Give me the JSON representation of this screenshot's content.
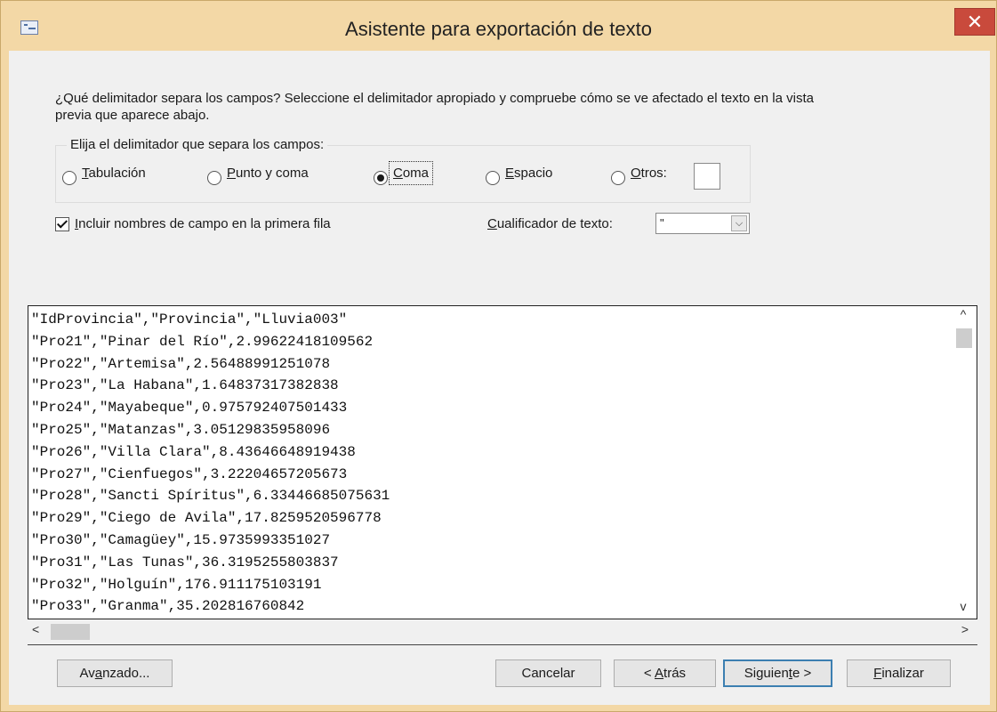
{
  "window": {
    "title": "Asistente para exportación de texto",
    "close_glyph": "✕",
    "icon": "form-icon"
  },
  "instructions": {
    "line1": "¿Qué delimitador separa los campos? Seleccione el delimitador apropiado y compruebe cómo se ve afectado el texto en la vista",
    "line2": "previa que aparece abajo."
  },
  "delimiter_group": {
    "legend": "Elija el delimitador que separa los campos:",
    "options": [
      {
        "label_first": "T",
        "label_rest": "abulación",
        "selected": false
      },
      {
        "label_first": "P",
        "label_rest": "unto y coma",
        "selected": false
      },
      {
        "label_first": "C",
        "label_rest": "oma",
        "selected": true
      },
      {
        "label_first": "E",
        "label_rest": "spacio",
        "selected": false
      },
      {
        "label_first": "O",
        "label_rest": "tros:",
        "selected": false
      }
    ],
    "otros_value": ""
  },
  "include_names": {
    "label_first": "I",
    "label_rest": "ncluir nombres de campo en la primera fila",
    "checked": true
  },
  "qualifier": {
    "label_first": "C",
    "label_rest": "ualificador de texto:",
    "value": "\""
  },
  "preview": {
    "lines": [
      "\"IdProvincia\",\"Provincia\",\"Lluvia003\"",
      "\"Pro21\",\"Pinar del Río\",2.99622418109562",
      "\"Pro22\",\"Artemisa\",2.56488991251078",
      "\"Pro23\",\"La Habana\",1.64837317382838",
      "\"Pro24\",\"Mayabeque\",0.975792407501433",
      "\"Pro25\",\"Matanzas\",3.05129835958096",
      "\"Pro26\",\"Villa Clara\",8.43646648919438",
      "\"Pro27\",\"Cienfuegos\",3.22204657205673",
      "\"Pro28\",\"Sancti Spíritus\",6.33446685075631",
      "\"Pro29\",\"Ciego de Avila\",17.8259520596778",
      "\"Pro30\",\"Camagüey\",15.9735993351027",
      "\"Pro31\",\"Las Tunas\",36.3195255803837",
      "\"Pro32\",\"Holguín\",176.911175103191",
      "\"Pro33\",\"Granma\",35.202816760842"
    ]
  },
  "scroll": {
    "up": "^",
    "down": "v",
    "left": "<",
    "right": ">"
  },
  "buttons": {
    "advanced": {
      "pre": "Av",
      "u": "a",
      "post": "nzado..."
    },
    "cancel": {
      "label": "Cancelar"
    },
    "back": {
      "pre": "< ",
      "u": "A",
      "post": "trás"
    },
    "next": {
      "pre": "Siguien",
      "u": "t",
      "post": "e >"
    },
    "finish": {
      "pre": "",
      "u": "F",
      "post": "inalizar"
    }
  },
  "colors": {
    "frame": "#f3d8a6",
    "close": "#c94a3c",
    "default_button_border": "#3c7fb1"
  }
}
